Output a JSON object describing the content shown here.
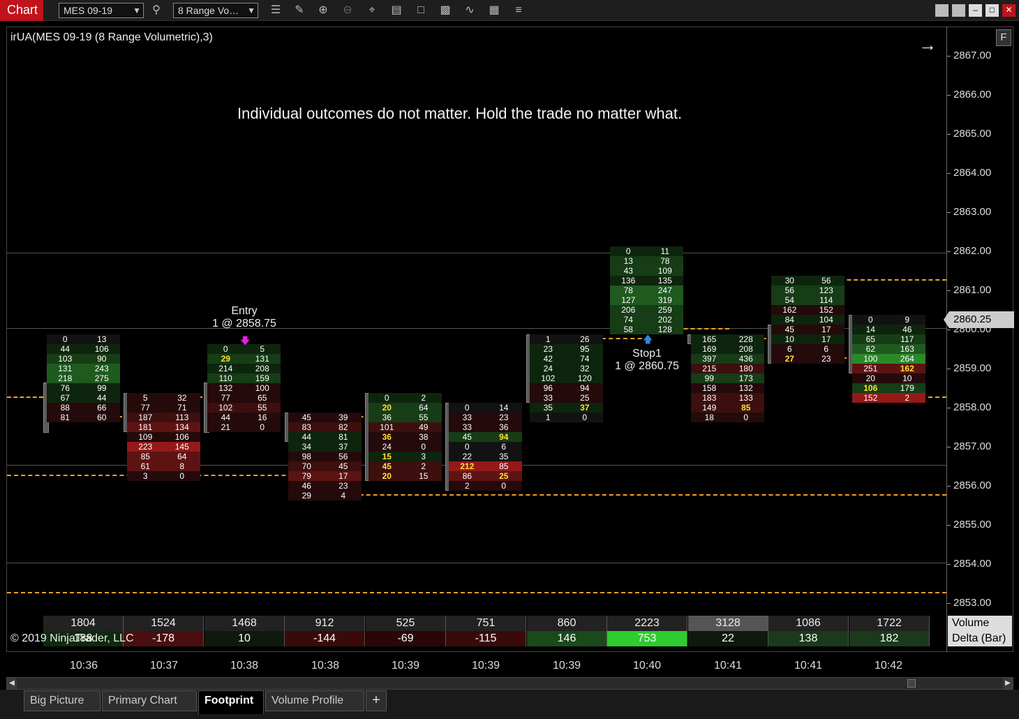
{
  "toolbar": {
    "title": "Chart",
    "instrument": "MES 09-19",
    "bar_type": "8 Range Vo…",
    "icons": [
      "search-icon",
      "bar-style-icon",
      "draw-icon",
      "zoom-in-icon",
      "zoom-out-icon",
      "crosshair-icon",
      "properties-icon",
      "template-icon",
      "indicators-icon",
      "strategies-icon",
      "data-box-icon",
      "more-icon"
    ]
  },
  "chart": {
    "indicator_label": "irUA(MES 09-19 (8 Range Volumetric),3)",
    "message": "Individual outcomes do not matter. Hold the trade no matter what.",
    "f_button": "F",
    "nav_arrow": "→",
    "current_price": "2860.25",
    "price_ticks": [
      "2867.00",
      "2866.00",
      "2865.00",
      "2864.00",
      "2863.00",
      "2862.00",
      "2861.00",
      "2860.00",
      "2859.00",
      "2858.00",
      "2857.00",
      "2856.00",
      "2855.00",
      "2854.00",
      "2853.00"
    ],
    "entry": {
      "title": "Entry",
      "detail": "1 @ 2858.75"
    },
    "stop": {
      "title": "Stop1",
      "detail": "1 @ 2860.75"
    },
    "copyright": "© 2019 NinjaTrader, LLC",
    "colors": {
      "dashed_line": "#f0a020",
      "accent_red": "#c0131b",
      "highlight": "#ffe033"
    }
  },
  "bars": [
    {
      "rows": [
        [
          "0",
          "13"
        ],
        [
          "44",
          "106"
        ],
        [
          "103",
          "90"
        ],
        [
          "131",
          "243"
        ],
        [
          "218",
          "275"
        ],
        [
          "76",
          "99"
        ],
        [
          "67",
          "44"
        ],
        [
          "88",
          "66"
        ],
        [
          "81",
          "60"
        ]
      ]
    },
    {
      "rows": [
        [
          "5",
          "32"
        ],
        [
          "77",
          "71"
        ],
        [
          "187",
          "113"
        ],
        [
          "181",
          "134"
        ],
        [
          "109",
          "106"
        ],
        [
          "223",
          "145"
        ],
        [
          "85",
          "64"
        ],
        [
          "61",
          "8"
        ],
        [
          "3",
          "0"
        ]
      ]
    },
    {
      "rows": [
        [
          "0",
          "5"
        ],
        [
          "29",
          "131"
        ],
        [
          "214",
          "208"
        ],
        [
          "110",
          "159"
        ],
        [
          "132",
          "100"
        ],
        [
          "77",
          "65"
        ],
        [
          "102",
          "55"
        ],
        [
          "44",
          "16"
        ],
        [
          "21",
          "0"
        ]
      ]
    },
    {
      "rows": [
        [
          "45",
          "39"
        ],
        [
          "83",
          "82"
        ],
        [
          "44",
          "81"
        ],
        [
          "34",
          "37"
        ],
        [
          "98",
          "56"
        ],
        [
          "70",
          "45"
        ],
        [
          "79",
          "17"
        ],
        [
          "46",
          "23"
        ],
        [
          "29",
          "4"
        ]
      ]
    },
    {
      "rows": [
        [
          "0",
          "2"
        ],
        [
          "20",
          "64"
        ],
        [
          "36",
          "55"
        ],
        [
          "101",
          "49"
        ],
        [
          "36",
          "38"
        ],
        [
          "24",
          "0"
        ],
        [
          "15",
          "3"
        ],
        [
          "45",
          "2"
        ],
        [
          "20",
          "15"
        ]
      ]
    },
    {
      "rows": [
        [
          "0",
          "14"
        ],
        [
          "33",
          "23"
        ],
        [
          "33",
          "36"
        ],
        [
          "45",
          "94"
        ],
        [
          "0",
          "6"
        ],
        [
          "22",
          "35"
        ],
        [
          "212",
          "85"
        ],
        [
          "86",
          "25"
        ],
        [
          "2",
          "0"
        ]
      ]
    },
    {
      "rows": [
        [
          "1",
          "26"
        ],
        [
          "23",
          "95"
        ],
        [
          "42",
          "74"
        ],
        [
          "24",
          "32"
        ],
        [
          "102",
          "120"
        ],
        [
          "96",
          "94"
        ],
        [
          "33",
          "25"
        ],
        [
          "35",
          "37"
        ],
        [
          "1",
          "0"
        ]
      ]
    },
    {
      "rows": [
        [
          "0",
          "11"
        ],
        [
          "13",
          "78"
        ],
        [
          "43",
          "109"
        ],
        [
          "136",
          "135"
        ],
        [
          "78",
          "247"
        ],
        [
          "127",
          "319"
        ],
        [
          "206",
          "259"
        ],
        [
          "74",
          "202"
        ],
        [
          "58",
          "128"
        ]
      ]
    },
    {
      "rows": [
        [
          "165",
          "228"
        ],
        [
          "169",
          "208"
        ],
        [
          "397",
          "436"
        ],
        [
          "215",
          "180"
        ],
        [
          "99",
          "173"
        ],
        [
          "158",
          "132"
        ],
        [
          "183",
          "133"
        ],
        [
          "149",
          "85"
        ],
        [
          "18",
          "0"
        ]
      ]
    },
    {
      "rows": [
        [
          "30",
          "56"
        ],
        [
          "56",
          "123"
        ],
        [
          "54",
          "114"
        ],
        [
          "162",
          "152"
        ],
        [
          "84",
          "104"
        ],
        [
          "45",
          "17"
        ],
        [
          "10",
          "17"
        ],
        [
          "6",
          "6"
        ],
        [
          "27",
          "23"
        ]
      ]
    },
    {
      "rows": [
        [
          "0",
          "9"
        ],
        [
          "14",
          "46"
        ],
        [
          "65",
          "117"
        ],
        [
          "62",
          "163"
        ],
        [
          "100",
          "264"
        ],
        [
          "251",
          "162"
        ],
        [
          "20",
          "10"
        ],
        [
          "106",
          "179"
        ],
        [
          "152",
          "2"
        ]
      ]
    }
  ],
  "volume": {
    "label": "Volume",
    "values": [
      "1804",
      "1524",
      "1468",
      "912",
      "525",
      "751",
      "860",
      "2223",
      "3128",
      "1086",
      "1722"
    ]
  },
  "delta": {
    "label": "Delta (Bar)",
    "values": [
      "188",
      "-178",
      "10",
      "-144",
      "-69",
      "-115",
      "146",
      "753",
      "22",
      "138",
      "182"
    ]
  },
  "time_labels": [
    "10:36",
    "10:37",
    "10:38",
    "10:38",
    "10:39",
    "10:39",
    "10:39",
    "10:40",
    "10:41",
    "10:41",
    "10:42"
  ],
  "tabs": [
    {
      "label": "Big Picture",
      "active": false
    },
    {
      "label": "Primary Chart",
      "active": false
    },
    {
      "label": "Footprint",
      "active": true
    },
    {
      "label": "Volume Profile",
      "active": false
    }
  ],
  "add_tab": "+"
}
